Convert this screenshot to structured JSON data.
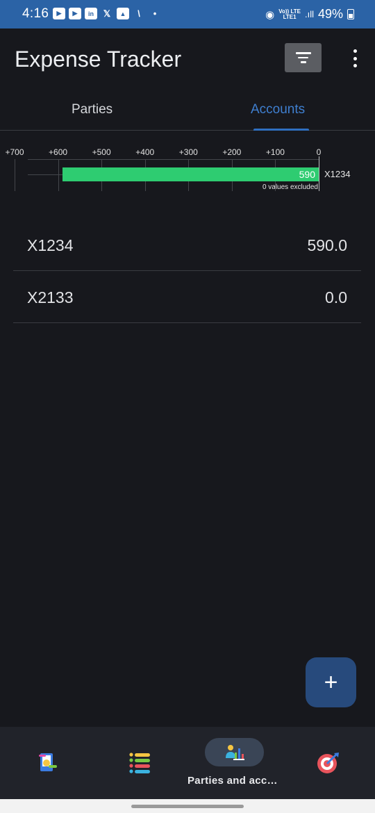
{
  "status": {
    "time": "4:16",
    "network": "Vo)) LTE",
    "network_sub": "LTE1",
    "battery": "49%"
  },
  "app": {
    "title": "Expense Tracker"
  },
  "tabs": [
    {
      "label": "Parties",
      "active": false
    },
    {
      "label": "Accounts",
      "active": true
    }
  ],
  "chart_data": {
    "type": "bar",
    "orientation": "horizontal",
    "direction": "right-to-left",
    "categories": [
      "X1234"
    ],
    "values": [
      590
    ],
    "value_labels": [
      "590"
    ],
    "tick_labels": [
      "+700",
      "+600",
      "+500",
      "+400",
      "+300",
      "+200",
      "+100",
      "0"
    ],
    "tick_values": [
      700,
      600,
      500,
      400,
      300,
      200,
      100,
      0
    ],
    "xlim": [
      0,
      700
    ],
    "bar_color": "#2ecc71",
    "note": "0 values excluded"
  },
  "accounts": [
    {
      "name": "X1234",
      "amount": "590.0"
    },
    {
      "name": "X2133",
      "amount": "0.0"
    }
  ],
  "fab": {
    "label": "+"
  },
  "bottom_nav": {
    "items": [
      "receipt-icon",
      "list-icon",
      "parties-accounts-icon",
      "target-icon"
    ],
    "active_label": "Parties and acc…"
  }
}
